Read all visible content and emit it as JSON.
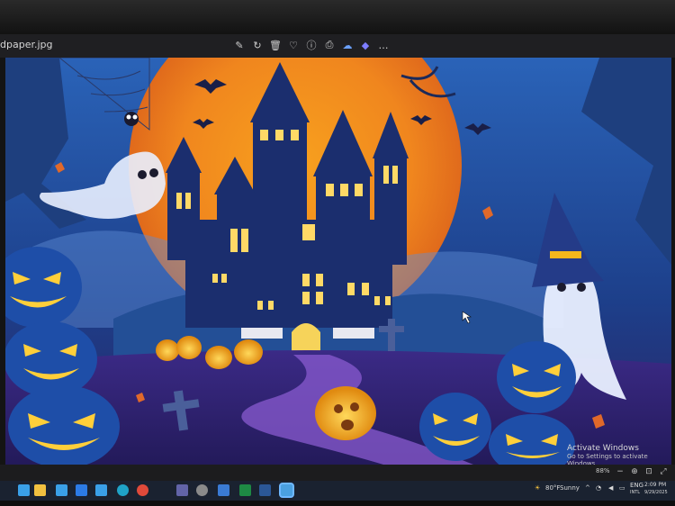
{
  "window": {
    "filename": "dpaper.jpg",
    "toolbar": [
      {
        "name": "edit-icon",
        "glyph": "✎"
      },
      {
        "name": "rotate-icon",
        "glyph": "↻"
      },
      {
        "name": "delete-icon",
        "glyph": "🗑"
      },
      {
        "name": "favorite-icon",
        "glyph": "♡"
      },
      {
        "name": "info-icon",
        "glyph": "ⓘ"
      },
      {
        "name": "print-icon",
        "glyph": "⎙"
      },
      {
        "name": "cloud-icon",
        "glyph": "☁"
      },
      {
        "name": "copilot-icon",
        "glyph": "◆"
      },
      {
        "name": "more-icon",
        "glyph": "…"
      }
    ]
  },
  "activation": {
    "title": "Activate Windows",
    "subtitle": "Go to Settings to activate Windows."
  },
  "statusbar": {
    "zoom": "88%",
    "icons": [
      "zoom-out-icon",
      "zoom-in-icon",
      "fit-icon",
      "fullscreen-icon"
    ]
  },
  "taskbar": {
    "apps": [
      {
        "name": "file-explorer-icon",
        "color": "#f0c040"
      },
      {
        "name": "store-icon",
        "color": "#3aa0e8"
      },
      {
        "name": "mail-icon",
        "color": "#2c7be5"
      },
      {
        "name": "photos-icon",
        "color": "#3aa0e8"
      },
      {
        "name": "edge-icon",
        "color": "#1fa3c8"
      },
      {
        "name": "chrome-icon",
        "color": "#e04a3a"
      },
      {
        "name": "teams-icon",
        "color": "#6264a7"
      },
      {
        "name": "settings-icon",
        "color": "#8a8a8a"
      },
      {
        "name": "onedrive-icon",
        "color": "#3a7bd5"
      },
      {
        "name": "excel-icon",
        "color": "#1e8a44"
      },
      {
        "name": "word-icon",
        "color": "#2b5797"
      },
      {
        "name": "photos-app-icon",
        "color": "#4aa0e0"
      }
    ],
    "weather": {
      "temp": "80°F",
      "condition": "Sunny"
    },
    "lang": "ENG",
    "region": "INTL",
    "time": "2:09 PM",
    "date": "9/29/2025"
  }
}
